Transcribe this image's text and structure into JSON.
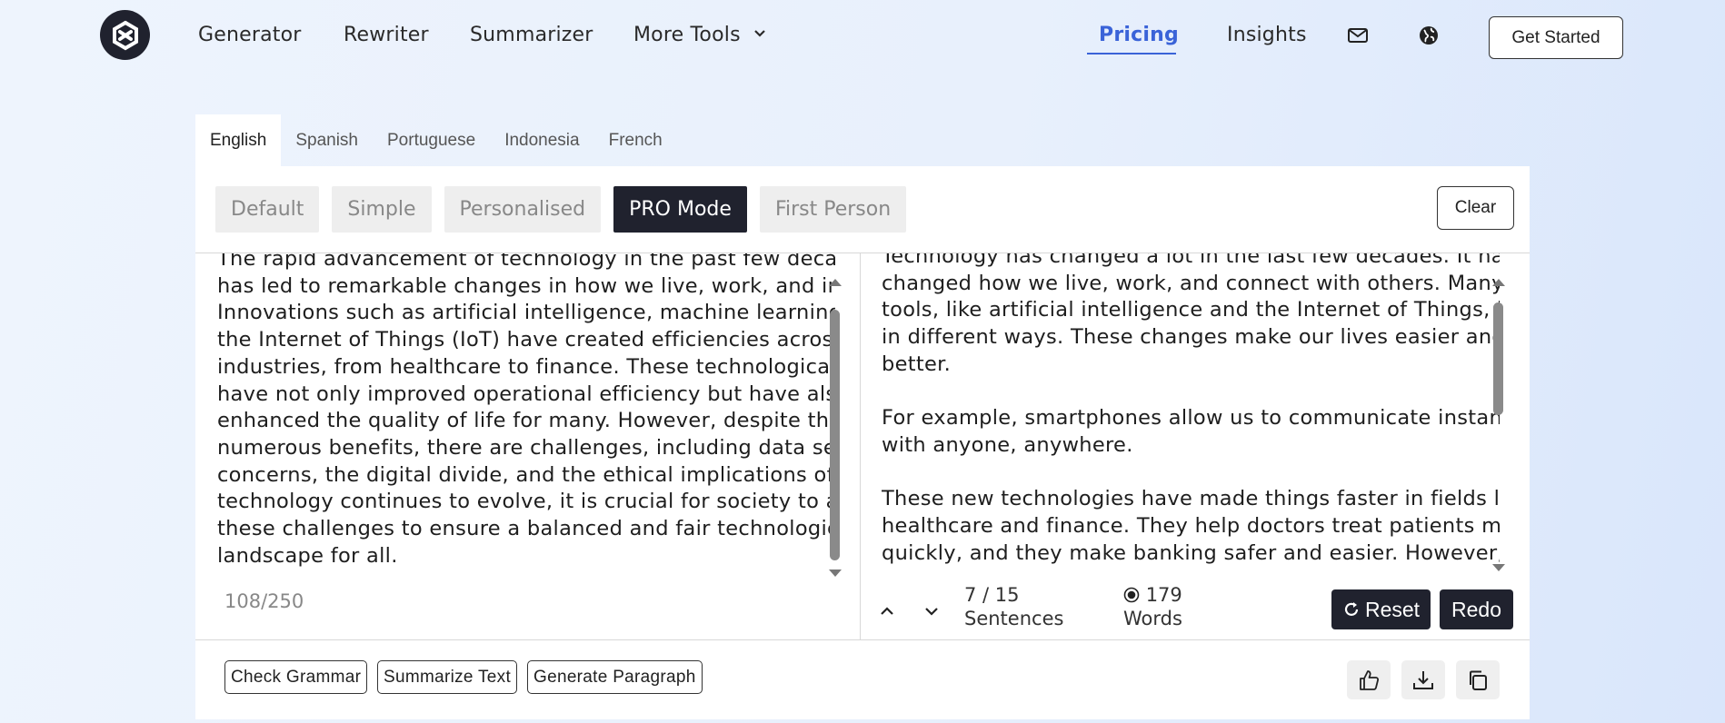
{
  "nav": {
    "links": [
      "Generator",
      "Rewriter",
      "Summarizer",
      "More Tools"
    ],
    "pricing": "Pricing",
    "insights": "Insights",
    "get_started": "Get Started"
  },
  "languages": [
    "English",
    "Spanish",
    "Portuguese",
    "Indonesia",
    "French"
  ],
  "active_language": "English",
  "modes": [
    "Default",
    "Simple",
    "Personalised",
    "PRO Mode",
    "First Person"
  ],
  "active_mode": "PRO Mode",
  "clear_label": "Clear",
  "input": {
    "lines": [
      "The rapid advancement of technology in the past few decades",
      "has led to remarkable changes in how we live, work, and interact.",
      "Innovations such as artificial intelligence, machine learning, and",
      "the Internet of Things (IoT) have created efficiencies across",
      "industries, from healthcare to finance. These technological shifts",
      "have not only improved operational efficiency but have also",
      "enhanced the quality of life for many. However, despite the",
      "numerous benefits, there are challenges, including data security",
      "concerns, the digital divide, and the ethical implications of AI. As",
      "technology continues to evolve, it is crucial for society to address",
      "these challenges to ensure a balanced and fair technological",
      "landscape for all."
    ],
    "counter": "108/250"
  },
  "output": {
    "lines": [
      "Technology has changed a lot in the last few decades. It has",
      "changed how we live, work, and connect with others. Many new",
      "tools, like artificial intelligence and the Internet of Things, help us",
      "in different ways. These changes make our lives easier and",
      "better.",
      "",
      "For example, smartphones allow us to communicate instantly",
      "with anyone, anywhere.",
      "",
      "These new technologies have made things faster in fields like",
      "healthcare and finance. They help doctors treat patients more",
      "quickly, and they make banking safer and easier. However, there"
    ],
    "sentence_count": "7 / 15",
    "sentence_label": "Sentences",
    "word_count": "179",
    "word_label": "Words",
    "reset_label": "Reset",
    "redo_label": "Redo"
  },
  "tools": [
    "Check Grammar",
    "Summarize Text",
    "Generate Paragraph"
  ],
  "colors": {
    "accent": "#3a63d8",
    "dark": "#20222e"
  }
}
